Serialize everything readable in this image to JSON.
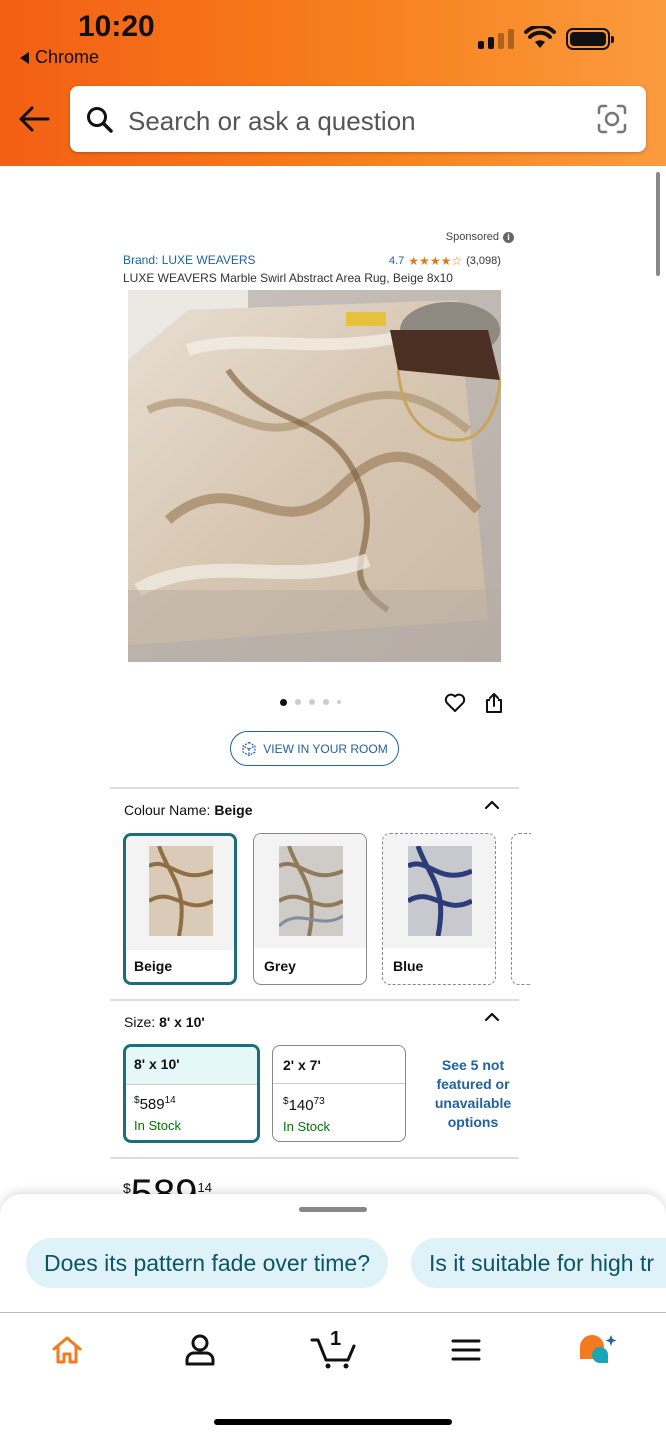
{
  "status_bar": {
    "time": "10:20",
    "back_app": "Chrome"
  },
  "search": {
    "placeholder": "Search or ask a question"
  },
  "product": {
    "sponsored": "Sponsored",
    "brand": "Brand: LUXE WEAVERS",
    "rating": "4.7",
    "stars_icon": "★★★★☆",
    "rating_count": "(3,098)",
    "title": "LUXE WEAVERS Marble Swirl Abstract Area Rug, Beige 8x10",
    "image_count": 5,
    "image_index": 1,
    "view_in_room": "VIEW IN YOUR ROOM"
  },
  "colour": {
    "label": "Colour Name:",
    "selected": "Beige",
    "options": [
      {
        "name": "Beige",
        "state": "selected"
      },
      {
        "name": "Grey",
        "state": "available"
      },
      {
        "name": "Blue",
        "state": "unavailable"
      }
    ]
  },
  "size": {
    "label": "Size:",
    "selected": "8' x 10'",
    "options": [
      {
        "name": "8' x 10'",
        "price_whole": "589",
        "price_frac": "14",
        "stock": "In Stock",
        "state": "selected"
      },
      {
        "name": "2' x 7'",
        "price_whole": "140",
        "price_frac": "73",
        "stock": "In Stock",
        "state": "available"
      }
    ],
    "more_link": "See 5 not featured or unavailable options"
  },
  "price": {
    "currency": "$",
    "whole": "589",
    "frac": "14"
  },
  "suggestions": [
    "Does its pattern fade over time?",
    "Is it suitable for high tr"
  ],
  "tabbar": {
    "cart_count": "1"
  },
  "colors": {
    "accent": "#f37a1f",
    "link": "#2162a1",
    "selected_border": "#1a6f7a",
    "in_stock": "#007600",
    "chip_bg": "#dff2f7"
  }
}
